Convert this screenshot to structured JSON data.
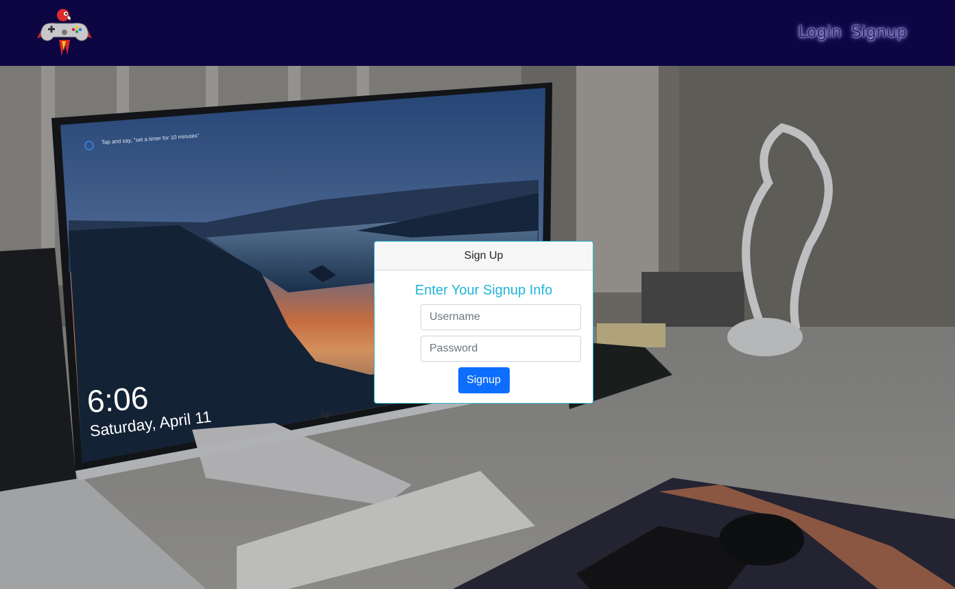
{
  "nav": {
    "logo_icon": "parrot-gamepad-logo-icon",
    "links": [
      "Login",
      "Signup"
    ]
  },
  "hero": {
    "image": "desk-with-monitor-photo",
    "screen_hint": "Tap and say, \"set a timer for 10 minutes\"",
    "screen_time": "6:06",
    "screen_date": "Saturday, April 11",
    "monitor_brand": "hp"
  },
  "card": {
    "header": "Sign Up",
    "title": "Enter Your Signup Info",
    "username_placeholder": "Username",
    "password_placeholder": "Password",
    "submit_label": "Signup"
  },
  "colors": {
    "navbar": "#0d0643",
    "accent_title": "#1fb4d8",
    "button": "#0d6efd",
    "card_border": "#2bb5cf"
  }
}
